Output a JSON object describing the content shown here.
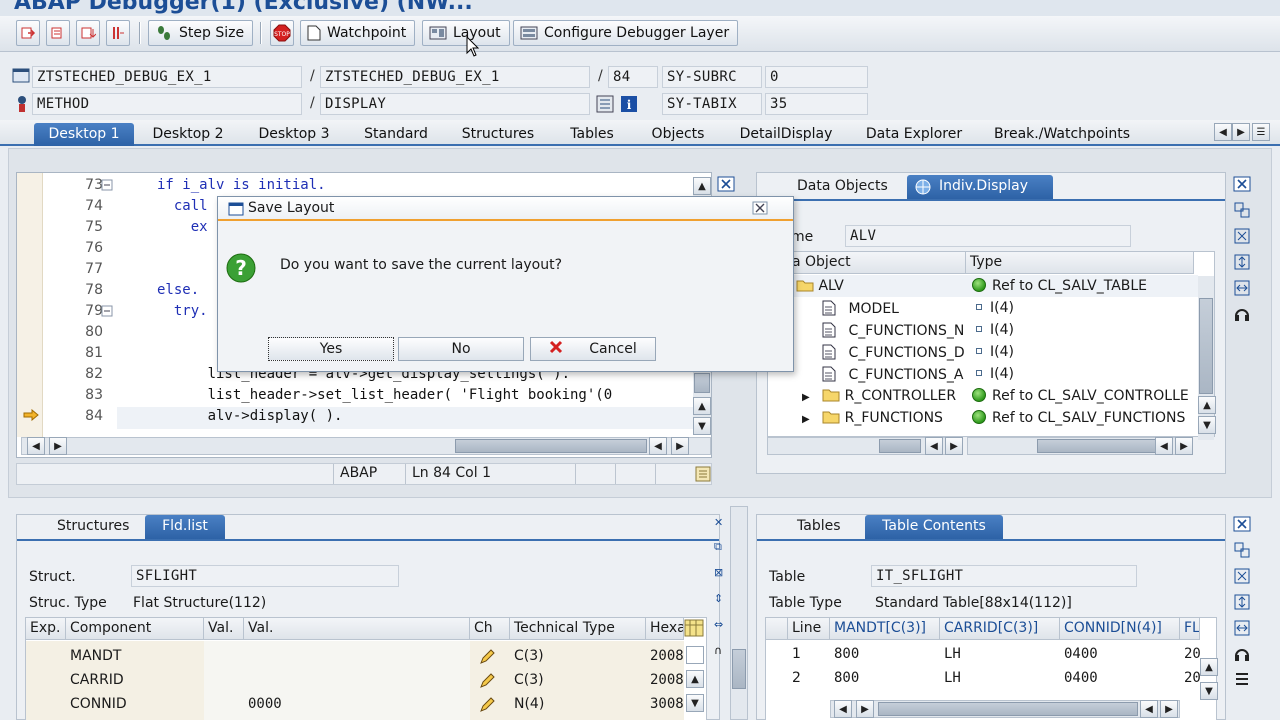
{
  "window": {
    "title": "ABAP Debugger(1) (Exclusive) (NW..."
  },
  "toolbar": {
    "step_size": "Step Size",
    "watchpoint": "Watchpoint",
    "layout": "Layout",
    "configure": "Configure Debugger Layer"
  },
  "info": {
    "program1": "ZTSTECHED_DEBUG_EX_1",
    "program2": "ZTSTECHED_DEBUG_EX_1",
    "line": "84",
    "subrc_label": "SY-SUBRC",
    "subrc_value": "0",
    "type1": "METHOD",
    "type2": "DISPLAY",
    "tabix_label": "SY-TABIX",
    "tabix_value": "35"
  },
  "tabs": [
    "Desktop 1",
    "Desktop 2",
    "Desktop 3",
    "Standard",
    "Structures",
    "Tables",
    "Objects",
    "DetailDisplay",
    "Data Explorer",
    "Break./Watchpoints"
  ],
  "code": {
    "lines": [
      {
        "num": "73",
        "text": "if i_alv is initial."
      },
      {
        "num": "74",
        "text": "  call"
      },
      {
        "num": "75",
        "text": "    ex"
      },
      {
        "num": "76",
        "text": ""
      },
      {
        "num": "77",
        "text": ""
      },
      {
        "num": "78",
        "text": "else."
      },
      {
        "num": "79",
        "text": "  try."
      },
      {
        "num": "80",
        "text": ""
      },
      {
        "num": "81",
        "text": ""
      },
      {
        "num": "82",
        "text": "      list_header = alv->get_display_settings( )."
      },
      {
        "num": "83",
        "text": "      list_header->set_list_header( 'Flight booking'(0"
      },
      {
        "num": "84",
        "text": "      alv->display( )."
      }
    ],
    "status_lang": "ABAP",
    "status_pos": "Ln 84 Col  1"
  },
  "right_panel": {
    "tab1": "Data Objects",
    "tab2": "Indiv.Display",
    "name_label": "me",
    "name_value": "ALV",
    "col_object": "a Object",
    "col_type": "Type",
    "rows": [
      {
        "name": "ALV",
        "type": "Ref to CL_SALV_TABLE"
      },
      {
        "name": "MODEL",
        "type": "I(4)"
      },
      {
        "name": "C_FUNCTIONS_N",
        "type": "I(4)"
      },
      {
        "name": "C_FUNCTIONS_D",
        "type": "I(4)"
      },
      {
        "name": "C_FUNCTIONS_A",
        "type": "I(4)"
      },
      {
        "name": "R_CONTROLLER",
        "type": "Ref to CL_SALV_CONTROLLE"
      },
      {
        "name": "R_FUNCTIONS",
        "type": "Ref to CL_SALV_FUNCTIONS"
      }
    ]
  },
  "bottom_left": {
    "tab1": "Structures",
    "tab2": "Fld.list",
    "struct_label": "Struct.",
    "struct_value": "SFLIGHT",
    "stype_label": "Struc. Type",
    "stype_value": "Flat Structure(112)",
    "headers": [
      "Exp.",
      "Component",
      "Val.",
      "Val.",
      "Ch",
      "Technical Type",
      "Hexa"
    ],
    "rows": [
      {
        "comp": "MANDT",
        "val": "",
        "type": "C(3)",
        "hex": "2008"
      },
      {
        "comp": "CARRID",
        "val": "",
        "type": "C(3)",
        "hex": "2008"
      },
      {
        "comp": "CONNID",
        "val": "0000",
        "type": "N(4)",
        "hex": "3008"
      }
    ]
  },
  "bottom_right": {
    "tab1": "Tables",
    "tab2": "Table Contents",
    "table_label": "Table",
    "table_value": "IT_SFLIGHT",
    "ttype_label": "Table Type",
    "ttype_value": "Standard Table[88x14(112)]",
    "headers": [
      "Line",
      "MANDT[C(3)]",
      "CARRID[C(3)]",
      "CONNID[N(4)]",
      "FL"
    ],
    "rows": [
      {
        "line": "1",
        "mandt": "800",
        "carrid": "LH",
        "connid": "0400",
        "fl": "20"
      },
      {
        "line": "2",
        "mandt": "800",
        "carrid": "LH",
        "connid": "0400",
        "fl": "20"
      }
    ]
  },
  "dialog": {
    "title": "Save Layout",
    "message": "Do you want to save the current layout?",
    "yes": "Yes",
    "no": "No",
    "cancel": "Cancel"
  }
}
